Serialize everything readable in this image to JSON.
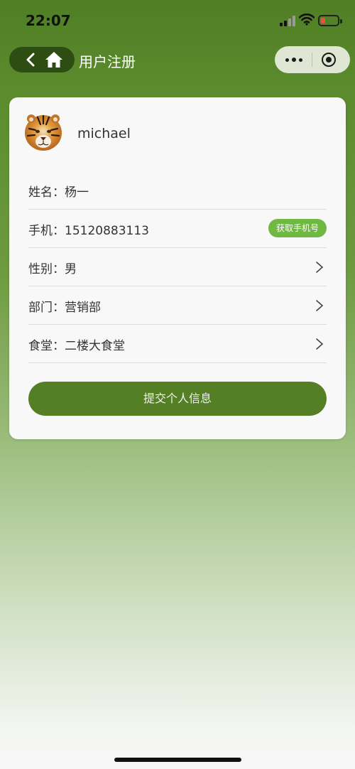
{
  "status": {
    "time": "22:07"
  },
  "nav": {
    "title": "用户注册"
  },
  "user": {
    "name": "michael"
  },
  "form": {
    "name": {
      "label": "姓名：杨一"
    },
    "phone": {
      "label": "手机：15120883113",
      "button": "获取手机号"
    },
    "gender": {
      "label": "性别：男"
    },
    "department": {
      "label": "部门：营销部"
    },
    "canteen": {
      "label": "食堂：二楼大食堂"
    }
  },
  "submit_label": "提交个人信息",
  "colors": {
    "nav_green": "#4f7e24",
    "accent_green": "#557f25",
    "button_light_green": "#6fb842",
    "battery_low": "#e5533a"
  },
  "icons": [
    "back-icon",
    "home-icon",
    "more-icon",
    "target-icon",
    "chevron-right-icon",
    "signal-icon",
    "wifi-icon",
    "battery-icon",
    "tiger-avatar"
  ]
}
